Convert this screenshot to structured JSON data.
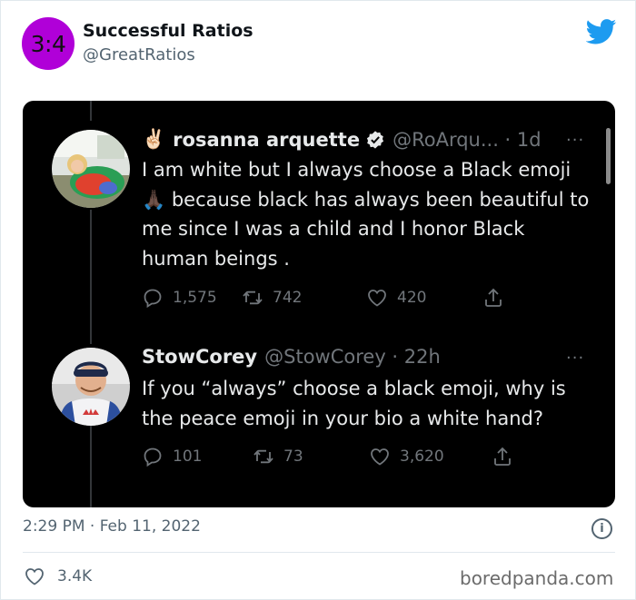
{
  "header": {
    "avatar_text": "3:4",
    "name": "Successful Ratios",
    "handle": "@GreatRatios",
    "bird_icon": "twitter-bird-icon",
    "bird_color": "#1d9bf0",
    "avatar_color": "#b000d8"
  },
  "screenshot": {
    "tweets": [
      {
        "emoji_prefix": "✌🏻",
        "name": "rosanna arquette",
        "verified": true,
        "handle_time": "@RoArqu... · 1d",
        "more": "···",
        "text_before_emoji": "I am white but I always choose a Black emoji",
        "inline_emoji": "🙏🏿",
        "text_after_emoji": " because black has always been beautiful to me since I was a child and I honor Black human beings .",
        "replies": "1,575",
        "retweets": "742",
        "likes": "420"
      },
      {
        "name": "StowCorey",
        "handle_time": "@StowCorey · 22h",
        "more": "···",
        "text": "If you “always” choose a black emoji, why is the peace emoji in your bio a white hand?",
        "replies": "101",
        "retweets": "73",
        "likes": "3,620"
      }
    ]
  },
  "footer": {
    "timestamp": "2:29 PM · Feb 11, 2022",
    "info_icon_text": "i",
    "likes": "3.4K",
    "watermark": "boredpanda.com"
  }
}
